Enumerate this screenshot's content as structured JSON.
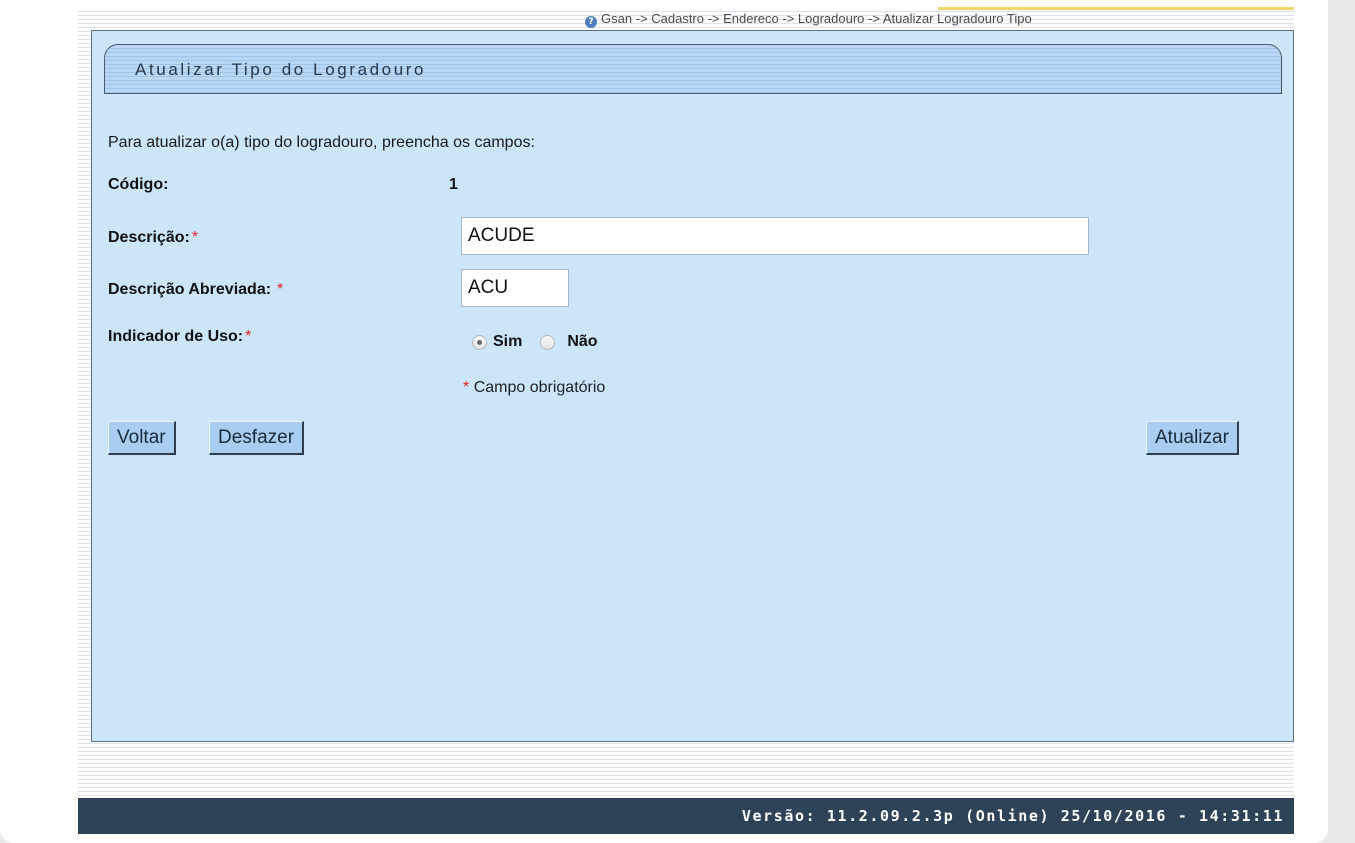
{
  "breadcrumb": "Gsan -> Cadastro -> Endereco -> Logradouro -> Atualizar Logradouro Tipo",
  "form": {
    "title": "Atualizar Tipo do Logradouro",
    "intro": "Para atualizar o(a) tipo do logradouro, preencha os campos:",
    "codigo_label": "Código:",
    "codigo_value": "1",
    "descricao_label": "Descrição:",
    "descricao_value": "ACUDE",
    "descricao_abreviada_label": "Descrição Abreviada:",
    "descricao_abreviada_value": "ACU",
    "indicador_label": "Indicador de Uso:",
    "radio_sim": "Sim",
    "radio_nao": "Não",
    "selected": "Sim",
    "required_mark": "*",
    "required_note": "Campo obrigatório"
  },
  "buttons": {
    "voltar": "Voltar",
    "desfazer": "Desfazer",
    "atualizar": "Atualizar"
  },
  "footer": {
    "version": "Versão: 11.2.09.2.3p (Online) 25/10/2016 - 14:31:11"
  },
  "colors": {
    "panel_bg": "#cbe5fa",
    "button_bg": "#a9cdf0",
    "footer_bg": "#2e4358",
    "required": "#e0261f"
  }
}
